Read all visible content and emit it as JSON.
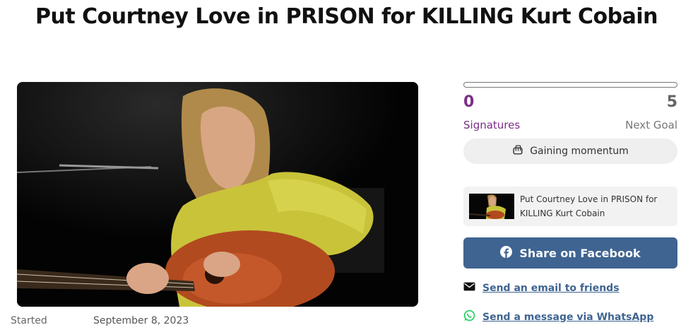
{
  "page": {
    "title": "Put Courtney Love in PRISON for KILLING Kurt Cobain"
  },
  "meta": {
    "started_label": "Started",
    "started_value": "September 8, 2023"
  },
  "progress": {
    "signatures": "0",
    "next_goal": "5",
    "signatures_label": "Signatures",
    "next_goal_label": "Next Goal",
    "fraction": 0
  },
  "momentum": {
    "label": "Gaining momentum"
  },
  "preview": {
    "text": "Put Courtney Love in PRISON for KILLING Kurt Cobain"
  },
  "share": {
    "facebook_label": "Share on Facebook",
    "email_label": "Send an email to friends",
    "whatsapp_label": "Send a message via WhatsApp"
  },
  "colors": {
    "accent_purple": "#7a2f86",
    "facebook_blue": "#3f6491",
    "whatsapp_green": "#25d366"
  }
}
